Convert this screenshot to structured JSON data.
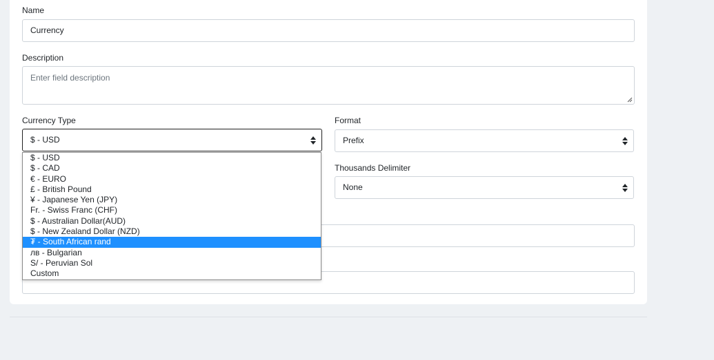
{
  "form": {
    "name_label": "Name",
    "name_value": "Currency",
    "description_label": "Description",
    "description_placeholder": "Enter field description",
    "currency_type_label": "Currency Type",
    "currency_type_value": "$ - USD",
    "format_label": "Format",
    "format_value": "Prefix",
    "thousands_label": "Thousands Delimiter",
    "thousands_value": "None"
  },
  "dropdown": {
    "options": [
      "$ - USD",
      "$ - CAD",
      "€ - EURO",
      "£ - British Pound",
      "¥ - Japanese Yen (JPY)",
      "Fr. - Swiss Franc (CHF)",
      "$ - Australian Dollar(AUD)",
      "$ - New Zealand Dollar (NZD)",
      "₮ - South African rand",
      "лв - Bulgarian",
      "S/ - Peruvian Sol",
      "Custom"
    ],
    "highlighted_index": 8
  },
  "colors": {
    "highlight": "#1e90ff",
    "page_background": "#eef1f4",
    "border": "#ced4da"
  },
  "icons": {
    "select_arrow": "sort-icon",
    "textarea_resize": "resize-grip-icon"
  }
}
